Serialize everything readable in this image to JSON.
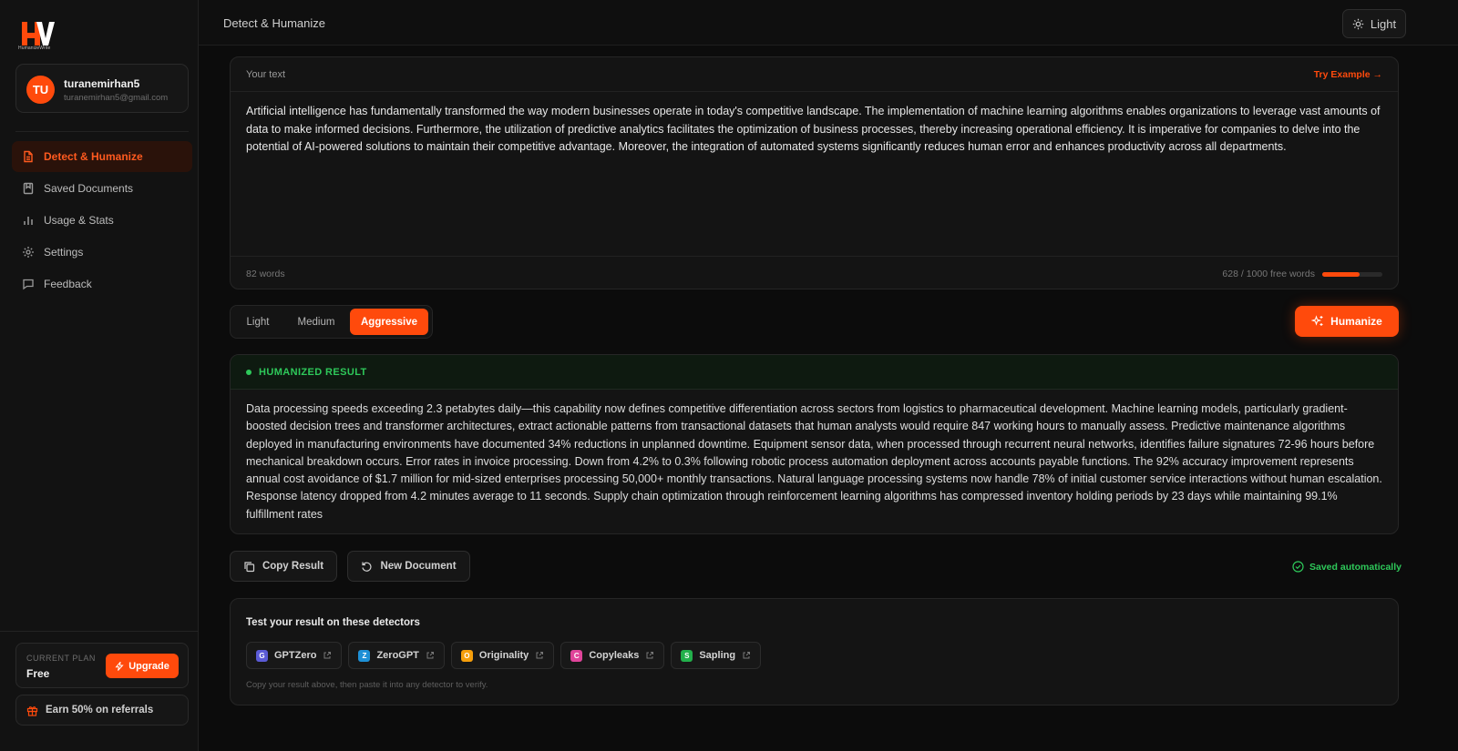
{
  "brand": {
    "logo_text": "HumanizeWrite",
    "accent": "#ff4a0c"
  },
  "user": {
    "initials": "TU",
    "name": "turanemirhan5",
    "email": "turanemirhan5@gmail.com"
  },
  "nav": [
    {
      "label": "Detect & Humanize",
      "icon": "document-icon",
      "active": true
    },
    {
      "label": "Saved Documents",
      "icon": "bookmark-icon",
      "active": false
    },
    {
      "label": "Usage & Stats",
      "icon": "bar-chart-icon",
      "active": false
    },
    {
      "label": "Settings",
      "icon": "gear-icon",
      "active": false
    },
    {
      "label": "Feedback",
      "icon": "message-icon",
      "active": false
    }
  ],
  "plan": {
    "label": "CURRENT PLAN",
    "value": "Free",
    "upgrade_label": "Upgrade"
  },
  "referral": {
    "label": "Earn 50% on referrals"
  },
  "header": {
    "title": "Detect & Humanize",
    "theme_label": "Light"
  },
  "input": {
    "label": "Your text",
    "try_example": "Try Example →",
    "text": "Artificial intelligence has fundamentally transformed the way modern businesses operate in today's competitive landscape. The implementation of machine learning algorithms enables organizations to leverage vast amounts of data to make informed decisions. Furthermore, the utilization of predictive analytics facilitates the optimization of business processes, thereby increasing operational efficiency. It is imperative for companies to delve into the potential of AI-powered solutions to maintain their competitive advantage. Moreover, the integration of automated systems significantly reduces human error and enhances productivity across all departments.",
    "word_count": "82 words",
    "quota_text": "628 / 1000 free words",
    "quota_fraction": 0.628
  },
  "modes": {
    "options": [
      "Light",
      "Medium",
      "Aggressive"
    ],
    "selected": "Aggressive"
  },
  "humanize_label": "Humanize",
  "result": {
    "label": "HUMANIZED RESULT",
    "status_color": "#2ec95a",
    "text": "Data processing speeds exceeding 2.3 petabytes daily—this capability now defines competitive differentiation across sectors from logistics to pharmaceutical development. Machine learning models, particularly gradient-boosted decision trees and transformer architectures, extract actionable patterns from transactional datasets that human analysts would require 847 working hours to manually assess. Predictive maintenance algorithms deployed in manufacturing environments have documented 34% reductions in unplanned downtime. Equipment sensor data, when processed through recurrent neural networks, identifies failure signatures 72-96 hours before mechanical breakdown occurs. Error rates in invoice processing. Down from 4.2% to 0.3% following robotic process automation deployment across accounts payable functions. The 92% accuracy improvement represents annual cost avoidance of $1.7 million for mid-sized enterprises processing 50,000+ monthly transactions. Natural language processing systems now handle 78% of initial customer service interactions without human escalation. Response latency dropped from 4.2 minutes average to 11 seconds. Supply chain optimization through reinforcement learning algorithms has compressed inventory holding periods by 23 days while maintaining 99.1% fulfillment rates"
  },
  "actions": {
    "copy_label": "Copy Result",
    "new_label": "New Document",
    "saved_note": "Saved automatically"
  },
  "detectors": {
    "title": "Test your result on these detectors",
    "items": [
      {
        "badge": "G",
        "name": "GPTZero",
        "color": "#5b5bd6"
      },
      {
        "badge": "Z",
        "name": "ZeroGPT",
        "color": "#1e90d6"
      },
      {
        "badge": "O",
        "name": "Originality",
        "color": "#f59e0b"
      },
      {
        "badge": "C",
        "name": "Copyleaks",
        "color": "#e0449a"
      },
      {
        "badge": "S",
        "name": "Sapling",
        "color": "#22b04b"
      }
    ],
    "hint": "Copy your result above, then paste it into any detector to verify."
  }
}
